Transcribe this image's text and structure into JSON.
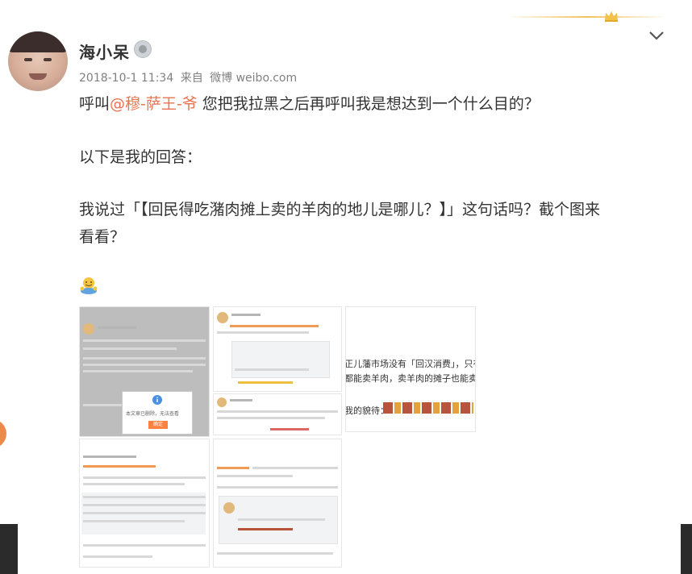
{
  "post": {
    "username": "海小呆",
    "date": "2018-10-1 11:34",
    "source_prefix": "来自",
    "source_app": "微博 weibo.com",
    "line1_prefix": "呼叫",
    "mention": "@穆-萨王-爷",
    "line1_suffix": " 您把我拉黑之后再呼叫我是想达到一个什么目的？",
    "line2": "以下是我的回答：",
    "line3": "我说过「【回民得吃潴肉摊上卖的羊肉的地儿是哪儿？】」这句话吗？截个图来",
    "line4": "看看？"
  },
  "thumbnails": {
    "t1_dialog_text": "本文章已删除，无法查看",
    "t1_dialog_button": "确定",
    "t3_line1": "正儿藩市场没有「回汉消费」，只有肉类",
    "t3_line2": "都能卖羊肉，卖羊肉的摊子也能卖潴肉。下",
    "t3_line3": "我的貌待："
  },
  "colors": {
    "mention": "#eb7350",
    "text": "#333333",
    "meta": "#808080"
  }
}
